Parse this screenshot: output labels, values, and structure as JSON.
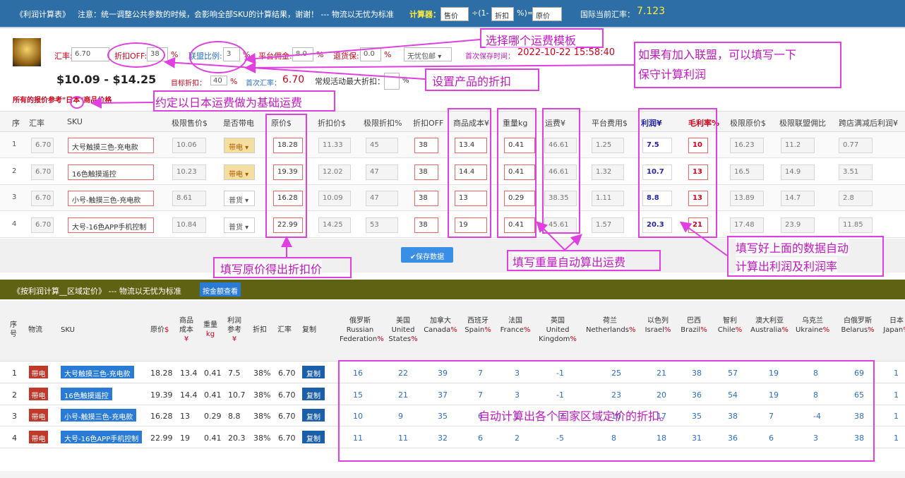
{
  "topbar": {
    "title": "《利润计算表》",
    "notice": "注意：统一调整公共参数的时候，会影响全部SKU的计算结果，谢谢！ --- 物流以无忧为标准",
    "calc_label": "计算器：",
    "calc_input1": "售价",
    "calc_op": "÷(1-",
    "calc_input2": "折扣",
    "calc_op2": "%)=",
    "calc_input3": "原价",
    "rate_label": "国际当前汇率：",
    "rate_value": "7.123"
  },
  "settings": {
    "rate_label": "汇率:",
    "rate_value": "6.70",
    "discount_label": "折扣OFF:",
    "discount_value": "38",
    "pct": "%",
    "alliance_label": "联盟比例:",
    "alliance_value": "3",
    "platform_label": "平台佣金:",
    "platform_value": "8.0",
    "refund_label": "退货保:",
    "refund_value": "0.0",
    "shipping_select": "无忧包邮",
    "saved_label": "首次保存时间：",
    "saved_time": "2022-10-22 15:58:40",
    "price_range": "$10.09 - $14.25",
    "target_label": "目标折扣：",
    "target_value": "40",
    "first_rate_label": "首次汇率：",
    "first_rate_value": "6.70",
    "max_discount_label": "常规活动最大折扣：",
    "note": "所有的报价参考\"日本\"商品价格"
  },
  "upper_table": {
    "headers": [
      "序",
      "汇率",
      "SKU",
      "极限售价$",
      "是否带电",
      "原价$",
      "折扣价$",
      "极限折扣%",
      "折扣OFF",
      "商品成本¥",
      "重量kg",
      "运费¥",
      "平台费用$",
      "利润¥",
      "毛利率%",
      "极限原价$",
      "极限联盟佣比",
      "跨店满减后利润¥"
    ],
    "rows": [
      {
        "no": "1",
        "rate": "6.70",
        "sku": "大号触摸三色-充电款",
        "limit_price": "10.06",
        "battery": "带电",
        "orig": "18.28",
        "disc_price": "11.33",
        "limit_disc": "45",
        "off": "38",
        "cost": "13.4",
        "weight": "0.41",
        "freight": "46.61",
        "platform": "1.25",
        "profit": "7.5",
        "margin": "10",
        "limit_orig": "16.23",
        "limit_alliance": "11.2",
        "cross_profit": "0.77"
      },
      {
        "no": "2",
        "rate": "6.70",
        "sku": "16色触摸遥控",
        "limit_price": "10.23",
        "battery": "带电",
        "orig": "19.39",
        "disc_price": "12.02",
        "limit_disc": "47",
        "off": "38",
        "cost": "14.4",
        "weight": "0.41",
        "freight": "46.61",
        "platform": "1.32",
        "profit": "10.7",
        "margin": "13",
        "limit_orig": "16.5",
        "limit_alliance": "14.9",
        "cross_profit": "3.51"
      },
      {
        "no": "3",
        "rate": "6.70",
        "sku": "小号-触摸三色-充电款",
        "limit_price": "8.61",
        "battery": "普货",
        "orig": "16.28",
        "disc_price": "10.09",
        "limit_disc": "47",
        "off": "38",
        "cost": "13",
        "weight": "0.29",
        "freight": "38.35",
        "platform": "1.11",
        "profit": "8.8",
        "margin": "13",
        "limit_orig": "13.89",
        "limit_alliance": "14.7",
        "cross_profit": "2.8"
      },
      {
        "no": "4",
        "rate": "6.70",
        "sku": "大号-16色APP手机控制",
        "limit_price": "10.84",
        "battery": "普货",
        "orig": "22.99",
        "disc_price": "14.25",
        "limit_disc": "53",
        "off": "38",
        "cost": "19",
        "weight": "0.41",
        "freight": "45.61",
        "platform": "1.57",
        "profit": "20.3",
        "margin": "21",
        "limit_orig": "17.48",
        "limit_alliance": "23.9",
        "cross_profit": "11.85"
      }
    ]
  },
  "save_button": "✔保存数据",
  "lower": {
    "title": "《按利润计算__区域定价》 --- 物流以无忧为标准",
    "view_button": "按金额查看",
    "headers": {
      "no": "序\n号",
      "logistics": "物流",
      "sku": "SKU",
      "orig": "原价",
      "orig_unit": "$",
      "cost": "商品\n成本",
      "cost_unit": "¥",
      "weight": "重量",
      "weight_unit": "kg",
      "profit": "利润\n参考",
      "profit_unit": "¥",
      "disc": "折扣",
      "rate": "汇率",
      "copy": "复制"
    },
    "countries": [
      {
        "cn": "俄罗斯",
        "en1": "Russian",
        "en2": "Federation"
      },
      {
        "cn": "美国",
        "en1": "United",
        "en2": "States"
      },
      {
        "cn": "加拿大",
        "en1": "",
        "en2": "Canada"
      },
      {
        "cn": "西班牙",
        "en1": "",
        "en2": "Spain"
      },
      {
        "cn": "法国",
        "en1": "",
        "en2": "France"
      },
      {
        "cn": "英国",
        "en1": "United",
        "en2": "Kingdom"
      },
      {
        "cn": "荷兰",
        "en1": "",
        "en2": "Netherlands"
      },
      {
        "cn": "以色列",
        "en1": "",
        "en2": "Israel"
      },
      {
        "cn": "巴西",
        "en1": "",
        "en2": "Brazil"
      },
      {
        "cn": "智利",
        "en1": "",
        "en2": "Chile"
      },
      {
        "cn": "澳大利亚",
        "en1": "",
        "en2": "Australia"
      },
      {
        "cn": "乌克兰",
        "en1": "",
        "en2": "Ukraine"
      },
      {
        "cn": "白俄罗斯",
        "en1": "",
        "en2": "Belarus"
      },
      {
        "cn": "日本",
        "en1": "",
        "en2": "Japan"
      }
    ],
    "pct": "%",
    "rows": [
      {
        "no": "1",
        "logistics": "带电",
        "sku": "大号触摸三色-充电款",
        "orig": "18.28",
        "cost": "13.4",
        "weight": "0.41",
        "profit": "7.5",
        "disc": "38%",
        "rate": "6.70",
        "copy": "复制",
        "vals": [
          "16",
          "22",
          "39",
          "7",
          "3",
          "-1",
          "25",
          "21",
          "38",
          "57",
          "19",
          "8",
          "69",
          "1"
        ]
      },
      {
        "no": "2",
        "logistics": "带电",
        "sku": "16色触摸遥控",
        "orig": "19.39",
        "cost": "14.4",
        "weight": "0.41",
        "profit": "10.7",
        "disc": "38%",
        "rate": "6.70",
        "copy": "复制",
        "vals": [
          "15",
          "21",
          "37",
          "7",
          "3",
          "-1",
          "23",
          "20",
          "36",
          "54",
          "19",
          "8",
          "65",
          "1"
        ]
      },
      {
        "no": "3",
        "logistics": "带电",
        "sku": "小号-触摸三色-充电款",
        "orig": "16.28",
        "cost": "13",
        "weight": "0.29",
        "profit": "8.8",
        "disc": "38%",
        "rate": "6.70",
        "copy": "复制",
        "vals": [
          "10",
          "9",
          "35",
          "6",
          "1",
          "-7",
          "10",
          "17",
          "35",
          "38",
          "7",
          "-4",
          "38",
          "1"
        ]
      },
      {
        "no": "4",
        "logistics": "带电",
        "sku": "大号-16色APP手机控制",
        "orig": "22.99",
        "cost": "19",
        "weight": "0.41",
        "profit": "20.3",
        "disc": "38%",
        "rate": "6.70",
        "copy": "复制",
        "vals": [
          "11",
          "11",
          "32",
          "6",
          "2",
          "-5",
          "8",
          "18",
          "31",
          "36",
          "6",
          "3",
          "38",
          "1"
        ]
      }
    ]
  },
  "annotations": {
    "a1": "选择哪个运费模板",
    "a2": "如果有加入联盟，可以填写一下",
    "a2b": "保守计算利润",
    "a3": "设置产品的折扣",
    "a4": "约定以日本运费做为基础运费",
    "a5": "填写原价得出折扣价",
    "a6": "填写重量自动算出运费",
    "a7": "填写好上面的数据自动",
    "a7b": "计算出利润及利润率",
    "a8": "自动计算出各个国家区域定价的折扣。"
  },
  "colors": {
    "topbar": "#2e6ea6",
    "olive": "#5f6212",
    "magenta": "#e040e0",
    "red": "#d0021b"
  }
}
